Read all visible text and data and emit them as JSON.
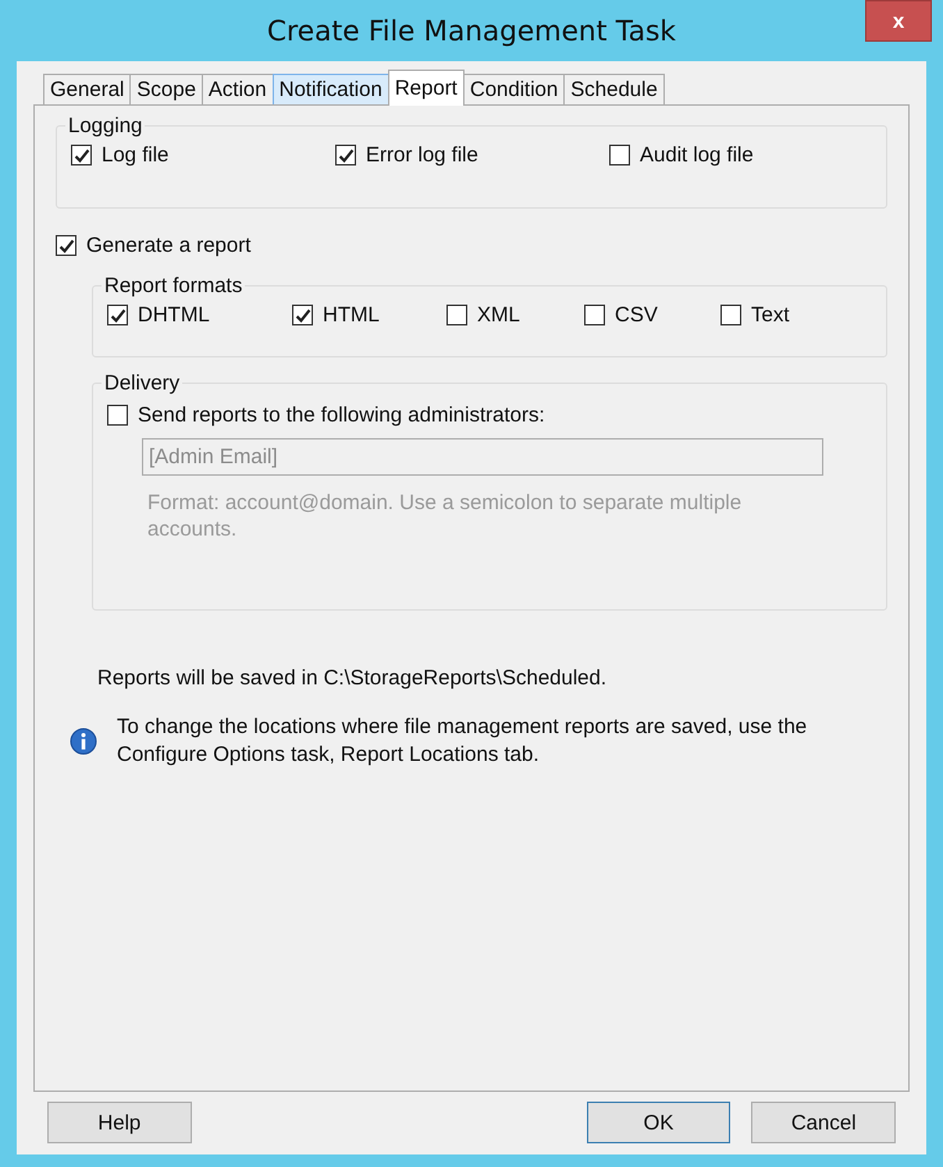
{
  "window": {
    "title": "Create File Management Task",
    "close": "x"
  },
  "tabs": [
    {
      "label": "General",
      "selected": false,
      "hover": false
    },
    {
      "label": "Scope",
      "selected": false,
      "hover": false
    },
    {
      "label": "Action",
      "selected": false,
      "hover": false
    },
    {
      "label": "Notification",
      "selected": false,
      "hover": true
    },
    {
      "label": "Report",
      "selected": true,
      "hover": false
    },
    {
      "label": "Condition",
      "selected": false,
      "hover": false
    },
    {
      "label": "Schedule",
      "selected": false,
      "hover": false
    }
  ],
  "logging": {
    "title": "Logging",
    "options": [
      {
        "label": "Log file",
        "checked": true
      },
      {
        "label": "Error log file",
        "checked": true
      },
      {
        "label": "Audit log file",
        "checked": false
      }
    ]
  },
  "generate_report": {
    "label": "Generate a report",
    "checked": true
  },
  "report_formats": {
    "title": "Report formats",
    "options": [
      {
        "label": "DHTML",
        "checked": true
      },
      {
        "label": "HTML",
        "checked": true
      },
      {
        "label": "XML",
        "checked": false
      },
      {
        "label": "CSV",
        "checked": false
      },
      {
        "label": "Text",
        "checked": false
      }
    ]
  },
  "delivery": {
    "title": "Delivery",
    "send": {
      "label": "Send reports to the following administrators:",
      "checked": false
    },
    "email_field": {
      "value": "[Admin Email]",
      "disabled": true
    },
    "hint": "Format: account@domain. Use a semicolon to separate multiple accounts."
  },
  "saved_location": "Reports will be saved in C:\\StorageReports\\Scheduled.",
  "info": "To change the locations where file management reports are saved, use the Configure Options task, Report Locations tab.",
  "buttons": [
    {
      "label": "Help",
      "focused": false
    },
    {
      "label": "OK",
      "focused": true
    },
    {
      "label": "Cancel",
      "focused": false
    }
  ]
}
